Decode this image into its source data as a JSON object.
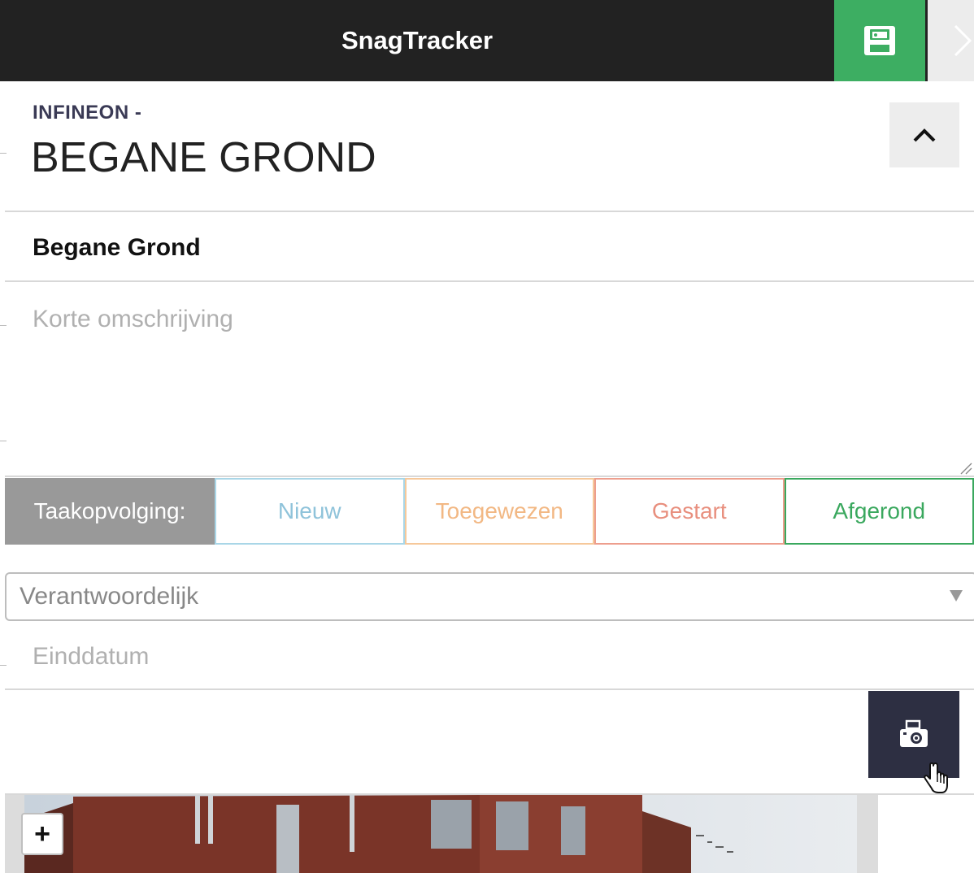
{
  "header": {
    "app_title": "SnagTracker",
    "save_icon": "save-icon",
    "next_icon": "chevron-right-icon"
  },
  "location": {
    "project_label": "INFINEON -",
    "title": "BEGANE GROND"
  },
  "snag": {
    "name": "Begane Grond",
    "description_placeholder": "Korte omschrijving"
  },
  "status": {
    "label": "Taakopvolging:",
    "options": [
      {
        "label": "Nieuw",
        "color": "#8fc3da"
      },
      {
        "label": "Toegewezen",
        "color": "#f2b884"
      },
      {
        "label": "Gestart",
        "color": "#e88f7e"
      },
      {
        "label": "Afgerond",
        "color": "#3aa85e"
      }
    ]
  },
  "responsible": {
    "selected": "Verantwoordelijk"
  },
  "due_date": {
    "placeholder": "Einddatum"
  },
  "map": {
    "zoom_in_label": "+"
  },
  "colors": {
    "topbar": "#222222",
    "save_green": "#3dae62",
    "camera_bg": "#2d2f42"
  }
}
